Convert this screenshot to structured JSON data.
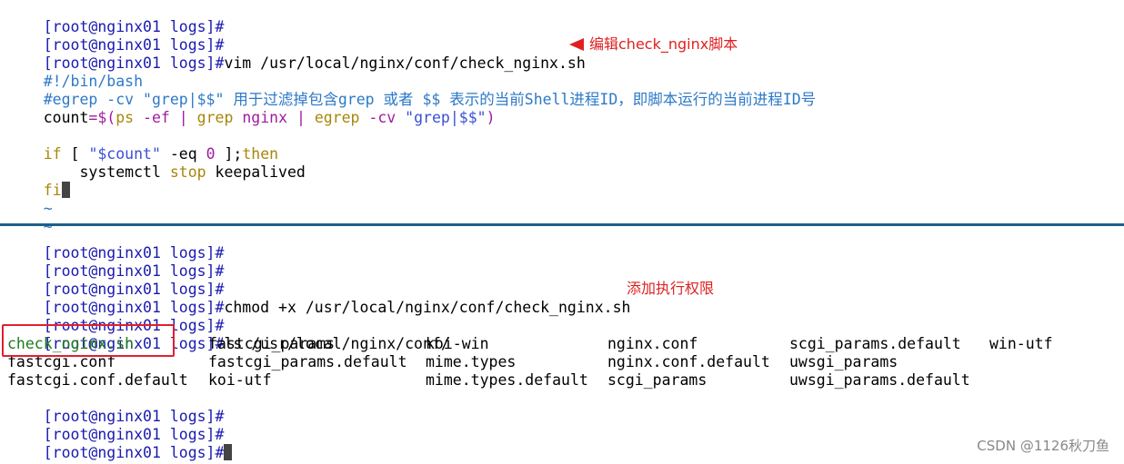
{
  "terminal": {
    "prompt": "[root@nginx01 logs]#",
    "top": {
      "cmd_vim": "vim /usr/local/nginx/conf/check_nginx.sh",
      "shebang": "#!/bin/bash",
      "comment": "#egrep -cv \"grep|$$\" 用于过滤掉包含grep 或者 $$ 表示的当前Shell进程ID，即脚本运行的当前进程ID号",
      "count_kw": "count",
      "count_eq": "=$(",
      "count_cmd1": "ps",
      "count_opt1": " -ef | ",
      "count_cmd2": "grep",
      "count_arg2": " nginx | ",
      "count_cmd3": "egrep",
      "count_opt3": " -cv ",
      "count_str": "\"grep|$$\"",
      "count_close": ")",
      "if_kw": "if",
      "if_open": " [ ",
      "if_var": "\"$count\"",
      "if_op": " -eq ",
      "if_num": "0",
      "if_close": " ];",
      "then_kw": "then",
      "indent_cmd": "    systemctl ",
      "stop_kw": "stop",
      "keepalived": " keepalived",
      "fi_kw": "fi",
      "tilde": "~"
    },
    "bottom": {
      "cmd_chmod": "chmod +x /usr/local/nginx/conf/check_nginx.sh",
      "cmd_ls": "ls /usr/local/nginx/conf/",
      "ls_rows": [
        [
          "check_nginx.sh",
          "fastcgi_params",
          "koi-win",
          "nginx.conf",
          "scgi_params.default",
          "win-utf"
        ],
        [
          "fastcgi.conf",
          "fastcgi_params.default",
          "mime.types",
          "nginx.conf.default",
          "uwsgi_params",
          ""
        ],
        [
          "fastcgi.conf.default",
          "koi-utf",
          "mime.types.default",
          "scgi_params",
          "uwsgi_params.default",
          ""
        ]
      ]
    }
  },
  "annotations": {
    "edit_script": "编辑check_nginx脚本",
    "add_exec": "添加执行权限"
  },
  "watermark": "CSDN @1126秋刀鱼",
  "colors": {
    "annotation": "#e02020",
    "prompt": "#1a1ab0",
    "comment": "#2d79c7",
    "keyword": "#a8860b",
    "string": "#3a4fd6",
    "executable": "#1f7a1f",
    "divider": "#1f5f8b"
  }
}
